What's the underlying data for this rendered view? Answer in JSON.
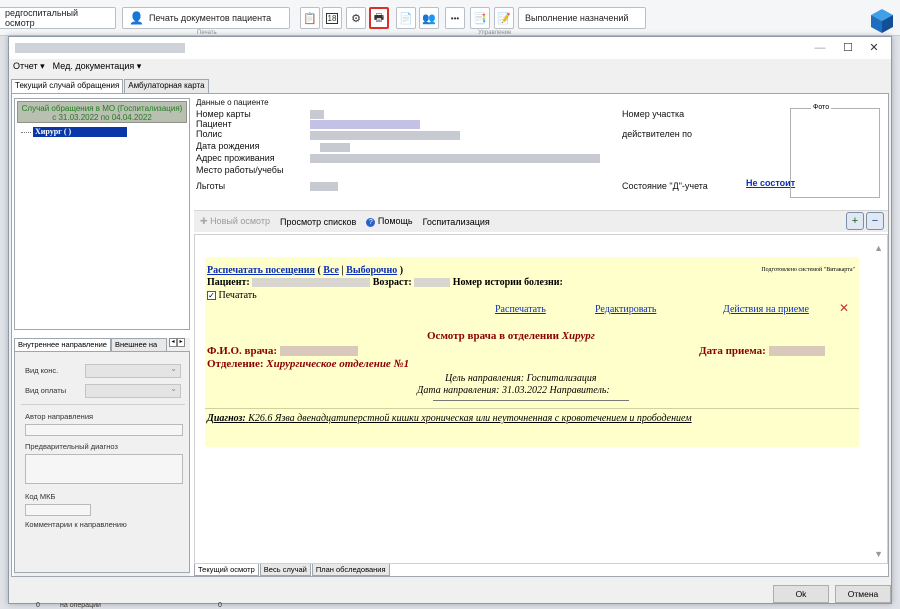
{
  "ribbon": {
    "btn_hospital_exam": "редгоспитальный осмотр",
    "btn_print_docs": "Печать документов пациента",
    "btn_appointments": "Выполнение назначений",
    "caption_print": "Печать",
    "caption_manage": "Управление",
    "icon_calendar_label": "18",
    "icon_more_label": "•••"
  },
  "window": {
    "minimize": "—",
    "maximize": "☐",
    "close": "✕"
  },
  "menu": {
    "report": "Отчет ▾",
    "med_docs": "Мед. документация ▾"
  },
  "tabs": {
    "current_case": "Текущий случай обращения",
    "ambulatory_card": "Амбулаторная карта"
  },
  "case_panel": {
    "line1": "Случай обращения в МО (Госпитализация)",
    "line2": "с 31.03.2022 по 04.04.2022",
    "tree_item": "Хирург (                )"
  },
  "direction_panel": {
    "tab_internal": "Внутреннее направление",
    "tab_external": "Внешнее на",
    "arrow_left": "◂",
    "arrow_right": "▸",
    "consult_type": "Вид конс.",
    "payment_type": "Вид оплаты",
    "author": "Автор направления",
    "prelim_diag": "Предварительный диагноз",
    "mkb_code": "Код МКБ",
    "comments": "Комментарии к направлению"
  },
  "patient": {
    "header": "Данные о пациенте",
    "card_number": "Номер карты",
    "patient": "Пациент",
    "policy": "Полис",
    "birth_date": "Дата рождения",
    "address": "Адрес проживания",
    "work": "Место работы/учебы",
    "benefits": "Льготы",
    "district": "Номер участка",
    "valid_until": "действителен по",
    "d_status_label": "Состояние \"Д\"-учета",
    "d_status_value": "Не состоит",
    "photo": "Фото"
  },
  "toolbar": {
    "new_exam": "Новый осмотр",
    "view_lists": "Просмотр списков",
    "help": "Помощь",
    "hospitalization": "Госпитализация",
    "zoom_in": "+",
    "zoom_out": "−"
  },
  "document": {
    "print_visits": "Распечатать посещения",
    "paren_open": "(",
    "all": "Все",
    "sep": "|",
    "selective": "Выборочно",
    "paren_close": ")",
    "prepared_by": "Подготовлено системой \"Витакарта\"",
    "patient_label": "Пациент:",
    "age_label": "Возраст:",
    "history_label": "Номер истории болезни:",
    "print_check": "Печатать",
    "print_link": "Распечатать",
    "edit_link": "Редактировать",
    "actions_link": "Действия на приеме",
    "delete_mark": "✕",
    "exam_title": "Осмотр врача в отделении",
    "exam_specialty": "Хирург",
    "doctor_label": "Ф.И.О. врача:",
    "visit_date_label": "Дата приема:",
    "department_label": "Отделение:",
    "department_value": "Хирургическое отделение №1",
    "purpose": "Цель направления: Госпитализация",
    "direction_date": "Дата направления: 31.03.2022 Направитель:",
    "diagnosis_label": "Диагноз:",
    "diagnosis_value": "K26.6 Язва двенадцатиперстной кишки хроническая или неуточненная с кровотечением и прободением"
  },
  "bottom_tabs": {
    "current_exam": "Текущий осмотр",
    "whole_case": "Весь случай",
    "exam_plan": "План обследования"
  },
  "footer": {
    "ok": "Ok",
    "cancel": "Отмена",
    "bg_number": "0",
    "bg_text": "на операции",
    "bg_number2": "0"
  },
  "colors": {
    "accent_link": "#0a2fb8",
    "doc_background": "#ffffcc",
    "highlight_border": "#d9302c",
    "tree_selection": "#0a37a8",
    "case_text": "#1f7d1f"
  }
}
